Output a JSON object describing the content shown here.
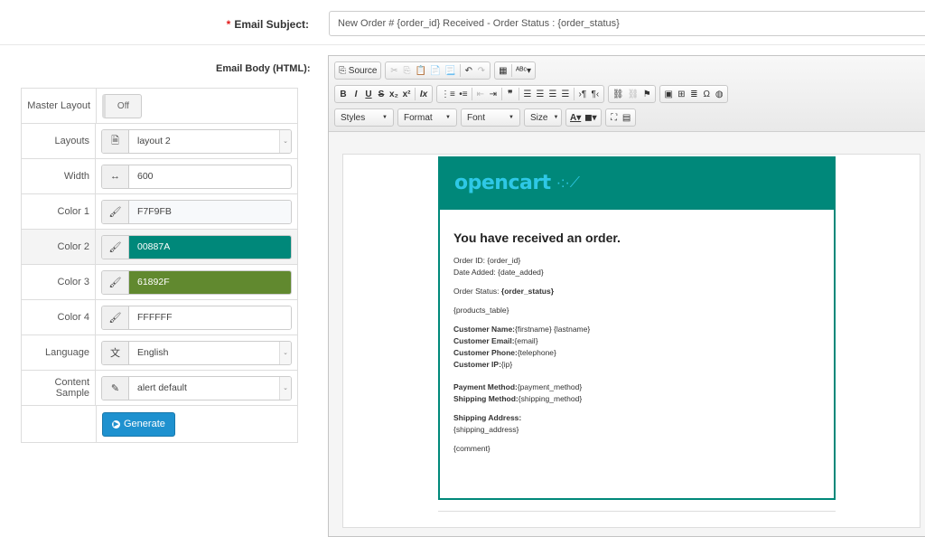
{
  "subject": {
    "required_mark": "*",
    "label": "Email Subject:",
    "value": "New Order # {order_id} Received - Order Status : {order_status}"
  },
  "body_label": "Email Body (HTML):",
  "settings": {
    "master_layout": {
      "label": "Master Layout",
      "toggle": "Off"
    },
    "layouts": {
      "label": "Layouts",
      "value": "layout 2"
    },
    "width": {
      "label": "Width",
      "value": "600"
    },
    "color1": {
      "label": "Color 1",
      "value": "F7F9FB"
    },
    "color2": {
      "label": "Color 2",
      "value": "00887A"
    },
    "color3": {
      "label": "Color 3",
      "value": "61892F"
    },
    "color4": {
      "label": "Color 4",
      "value": "FFFFFF"
    },
    "language": {
      "label": "Language",
      "value": "English"
    },
    "content_sample": {
      "label": "Content Sample",
      "value": "alert default"
    },
    "generate": "Generate"
  },
  "colors": {
    "color1": "#F7F9FB",
    "color2": "#00887A",
    "color3": "#61892F",
    "color4": "#FFFFFF",
    "button": "#1e91cf"
  },
  "toolbar": {
    "source": "Source",
    "styles": "Styles",
    "format": "Format",
    "font": "Font",
    "size": "Size"
  },
  "email": {
    "logo": "opencart",
    "heading": "You have received an order.",
    "order_id_label": "Order ID: ",
    "order_id": "{order_id}",
    "date_label": "Date Added: ",
    "date": "{date_added}",
    "status_label": "Order Status: ",
    "status": "{order_status}",
    "products": "{products_table}",
    "cust_name_label": "Customer Name:",
    "cust_name": "{firstname} {lastname}",
    "cust_email_label": "Customer Email:",
    "cust_email": "{email}",
    "cust_phone_label": "Customer Phone:",
    "cust_phone": "{telephone}",
    "cust_ip_label": "Customer IP:",
    "cust_ip": "{ip}",
    "payment_label": "Payment Method:",
    "payment": "{payment_method}",
    "shipping_label": "Shipping Method:",
    "shipping": "{shipping_method}",
    "address_label": "Shipping Address:",
    "address": "{shipping_address}",
    "comment": "{comment}"
  }
}
